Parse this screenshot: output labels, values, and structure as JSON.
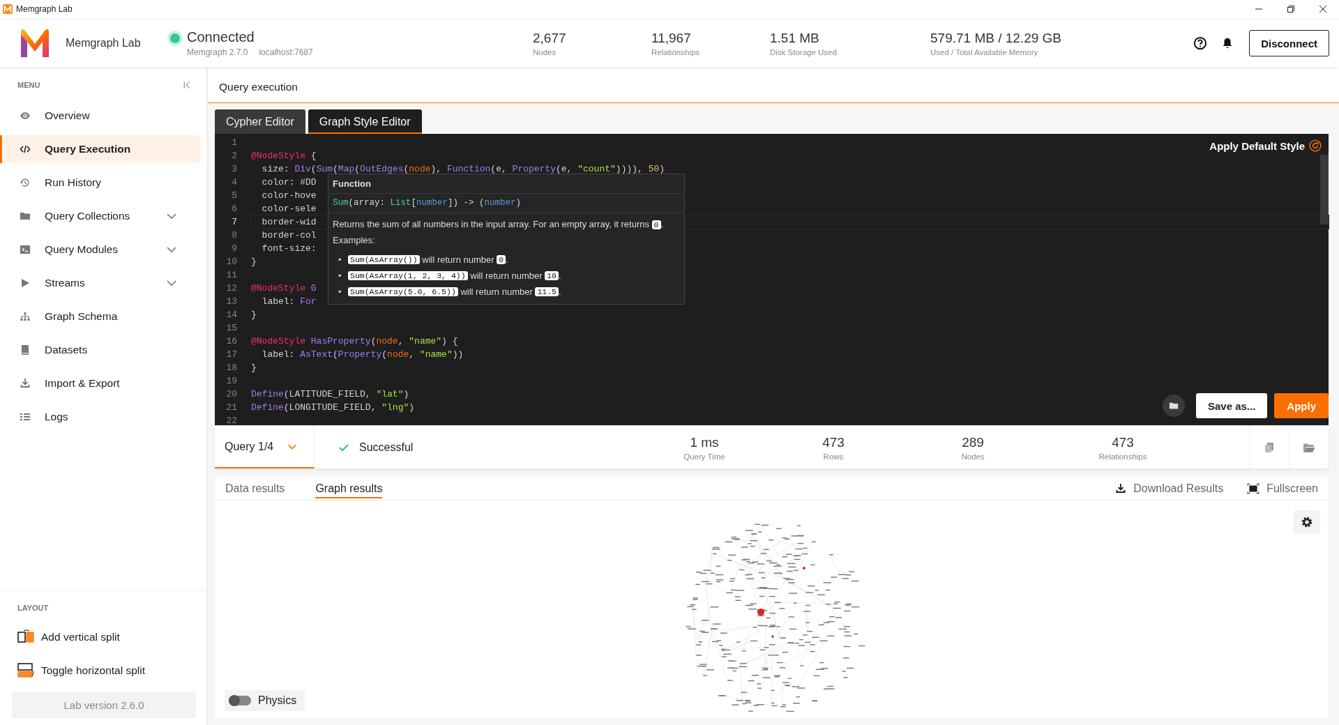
{
  "window": {
    "title": "Memgraph Lab"
  },
  "header": {
    "app_name": "Memgraph Lab",
    "connection": {
      "status": "Connected",
      "connected": true,
      "version": "Memgraph 2.7.0",
      "host": "localhost:7687"
    },
    "stats": [
      {
        "value": "2,677",
        "label": "Nodes"
      },
      {
        "value": "11,967",
        "label": "Relationships"
      },
      {
        "value": "1.51 MB",
        "label": "Disk Storage Used"
      },
      {
        "value": "579.71 MB / 12.29 GB",
        "label": "Used / Total Available Memory"
      }
    ],
    "disconnect_button": "Disconnect"
  },
  "sidebar": {
    "menu_heading": "MENU",
    "items": [
      {
        "label": "Overview",
        "selected": false,
        "expandable": false
      },
      {
        "label": "Query Execution",
        "selected": true,
        "expandable": false
      },
      {
        "label": "Run History",
        "selected": false,
        "expandable": false
      },
      {
        "label": "Query Collections",
        "selected": false,
        "expandable": true
      },
      {
        "label": "Query Modules",
        "selected": false,
        "expandable": true
      },
      {
        "label": "Streams",
        "selected": false,
        "expandable": true
      },
      {
        "label": "Graph Schema",
        "selected": false,
        "expandable": false
      },
      {
        "label": "Datasets",
        "selected": false,
        "expandable": false
      },
      {
        "label": "Import & Export",
        "selected": false,
        "expandable": false
      },
      {
        "label": "Logs",
        "selected": false,
        "expandable": false
      }
    ],
    "layout_heading": "LAYOUT",
    "layout_items": [
      {
        "label": "Add vertical split"
      },
      {
        "label": "Toggle horizontal split"
      }
    ],
    "version": "Lab version 2.6.0"
  },
  "page_title": "Query execution",
  "editor_tabs": [
    {
      "label": "Cypher Editor",
      "selected": false
    },
    {
      "label": "Graph Style Editor",
      "selected": true
    }
  ],
  "editor": {
    "apply_default": "Apply Default Style",
    "lines": [
      {
        "number": "1",
        "current": false
      },
      {
        "number": "2",
        "current": false,
        "tokens": [
          {
            "kind": "at",
            "text": "@NodeStyle"
          },
          {
            "kind": "plain",
            "text": " {"
          }
        ]
      },
      {
        "number": "3",
        "current": false,
        "tokens": [
          {
            "kind": "plain",
            "text": "  size: "
          },
          {
            "kind": "func",
            "text": "Div"
          },
          {
            "kind": "plain",
            "text": "("
          },
          {
            "kind": "func",
            "text": "Sum"
          },
          {
            "kind": "plain",
            "text": "("
          },
          {
            "kind": "func",
            "text": "Map"
          },
          {
            "kind": "plain",
            "text": "("
          },
          {
            "kind": "func",
            "text": "OutEdges"
          },
          {
            "kind": "plain",
            "text": "("
          },
          {
            "kind": "var",
            "text": "node"
          },
          {
            "kind": "plain",
            "text": "), "
          },
          {
            "kind": "func",
            "text": "Function"
          },
          {
            "kind": "plain",
            "text": "(e, "
          },
          {
            "kind": "func",
            "text": "Property"
          },
          {
            "kind": "plain",
            "text": "(e, "
          },
          {
            "kind": "str",
            "text": "\"count\""
          },
          {
            "kind": "plain",
            "text": ")))), "
          },
          {
            "kind": "num",
            "text": "50"
          },
          {
            "kind": "plain",
            "text": ")"
          }
        ]
      },
      {
        "number": "4",
        "current": false,
        "tokens": [
          {
            "kind": "plain",
            "text": "  color: #DD"
          }
        ]
      },
      {
        "number": "5",
        "current": false,
        "tokens": [
          {
            "kind": "plain",
            "text": "  color-hove"
          }
        ]
      },
      {
        "number": "6",
        "current": false,
        "tokens": [
          {
            "kind": "plain",
            "text": "  color-sele"
          }
        ]
      },
      {
        "number": "7",
        "current": true,
        "tokens": [
          {
            "kind": "plain",
            "text": "  border-wid"
          }
        ]
      },
      {
        "number": "8",
        "current": false,
        "tokens": [
          {
            "kind": "plain",
            "text": "  border-col"
          }
        ]
      },
      {
        "number": "9",
        "current": false,
        "tokens": [
          {
            "kind": "plain",
            "text": "  font-size:"
          }
        ]
      },
      {
        "number": "10",
        "current": false,
        "tokens": [
          {
            "kind": "plain",
            "text": "}"
          }
        ]
      },
      {
        "number": "11",
        "current": false
      },
      {
        "number": "12",
        "current": false,
        "tokens": [
          {
            "kind": "at",
            "text": "@NodeStyle"
          },
          {
            "kind": "func",
            "text": " G"
          }
        ]
      },
      {
        "number": "13",
        "current": false,
        "tokens": [
          {
            "kind": "plain",
            "text": "  label: "
          },
          {
            "kind": "func",
            "text": "For"
          }
        ]
      },
      {
        "number": "14",
        "current": false,
        "tokens": [
          {
            "kind": "plain",
            "text": "}"
          }
        ]
      },
      {
        "number": "15",
        "current": false
      },
      {
        "number": "16",
        "current": false,
        "tokens": [
          {
            "kind": "at",
            "text": "@NodeStyle"
          },
          {
            "kind": "func",
            "text": " HasProperty"
          },
          {
            "kind": "plain",
            "text": "("
          },
          {
            "kind": "var",
            "text": "node"
          },
          {
            "kind": "plain",
            "text": ", "
          },
          {
            "kind": "str",
            "text": "\"name\""
          },
          {
            "kind": "plain",
            "text": ") {"
          }
        ]
      },
      {
        "number": "17",
        "current": false,
        "tokens": [
          {
            "kind": "plain",
            "text": "  label: "
          },
          {
            "kind": "func",
            "text": "AsText"
          },
          {
            "kind": "plain",
            "text": "("
          },
          {
            "kind": "func",
            "text": "Property"
          },
          {
            "kind": "plain",
            "text": "("
          },
          {
            "kind": "var",
            "text": "node"
          },
          {
            "kind": "plain",
            "text": ", "
          },
          {
            "kind": "str",
            "text": "\"name\""
          },
          {
            "kind": "plain",
            "text": "))"
          }
        ]
      },
      {
        "number": "18",
        "current": false,
        "tokens": [
          {
            "kind": "plain",
            "text": "}"
          }
        ]
      },
      {
        "number": "19",
        "current": false
      },
      {
        "number": "20",
        "current": false,
        "tokens": [
          {
            "kind": "func",
            "text": "Define"
          },
          {
            "kind": "plain",
            "text": "(LATITUDE_FIELD, "
          },
          {
            "kind": "str",
            "text": "\"lat\""
          },
          {
            "kind": "plain",
            "text": ")"
          }
        ]
      },
      {
        "number": "21",
        "current": false,
        "tokens": [
          {
            "kind": "func",
            "text": "Define"
          },
          {
            "kind": "plain",
            "text": "(LONGITUDE_FIELD, "
          },
          {
            "kind": "str",
            "text": "\"lng\""
          },
          {
            "kind": "plain",
            "text": ")"
          }
        ]
      },
      {
        "number": "22",
        "current": false
      }
    ],
    "tooltip": {
      "title": "Function",
      "signature": [
        {
          "kind": "type",
          "text": "Sum"
        },
        {
          "kind": "plain",
          "text": "(array: "
        },
        {
          "kind": "type",
          "text": "List"
        },
        {
          "kind": "plain",
          "text": "["
        },
        {
          "kind": "param",
          "text": "number"
        },
        {
          "kind": "plain",
          "text": "]) -> ("
        },
        {
          "kind": "param",
          "text": "number"
        },
        {
          "kind": "plain",
          "text": ")"
        }
      ],
      "description": [
        {
          "kind": "text",
          "text": "Returns the sum of all numbers in the input array. For an empty array, it returns "
        },
        {
          "kind": "code",
          "text": "0"
        },
        {
          "kind": "text",
          "text": "."
        }
      ],
      "examples_label": "Examples:",
      "examples": [
        {
          "bullet": "•",
          "parts": [
            {
              "kind": "code",
              "text": "Sum(AsArray())"
            },
            {
              "kind": "text",
              "text": " will return number "
            },
            {
              "kind": "code",
              "text": "0"
            },
            {
              "kind": "text",
              "text": "."
            }
          ]
        },
        {
          "bullet": "•",
          "parts": [
            {
              "kind": "code",
              "text": "Sum(AsArray(1, 2, 3, 4))"
            },
            {
              "kind": "text",
              "text": " will return number "
            },
            {
              "kind": "code",
              "text": "10"
            },
            {
              "kind": "text",
              "text": "."
            }
          ]
        },
        {
          "bullet": "•",
          "parts": [
            {
              "kind": "code",
              "text": "Sum(AsArray(5.0, 6.5))"
            },
            {
              "kind": "text",
              "text": " will return number "
            },
            {
              "kind": "code",
              "text": "11.5"
            },
            {
              "kind": "text",
              "text": "."
            }
          ]
        }
      ]
    },
    "save_button": "Save as...",
    "apply_button": "Apply"
  },
  "results": {
    "query_selector": "Query 1/4",
    "status": "Successful",
    "success": true,
    "stats": [
      {
        "value": "1 ms",
        "label": "Query Time"
      },
      {
        "value": "473",
        "label": "Rows"
      },
      {
        "value": "289",
        "label": "Nodes"
      },
      {
        "value": "473",
        "label": "Relationships"
      }
    ],
    "tabs": [
      {
        "label": "Data results",
        "selected": false
      },
      {
        "label": "Graph results",
        "selected": true
      }
    ],
    "download": "Download Results",
    "fullscreen": "Fullscreen",
    "physics": {
      "label": "Physics",
      "on": false
    }
  }
}
